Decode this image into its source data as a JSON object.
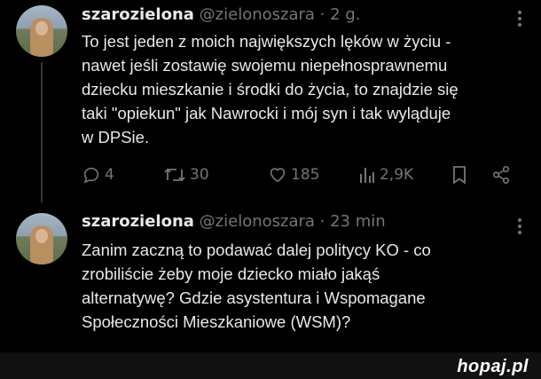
{
  "tweets": [
    {
      "name": "szarozielona",
      "handle": "@zielonoszara",
      "time": " · 2 g.",
      "text": "To jest jeden z moich największych lęków w życiu -\nnawet jeśli zostawię swojemu niepełnosprawnemu\ndziecku mieszkanie i środki do życia, to znajdzie się\ntaki \"opiekun\" jak Nawrocki i mój syn i tak wyląduje\nw DPSie.",
      "replies": "4",
      "retweets": "30",
      "likes": "185",
      "views": "2,9K"
    },
    {
      "name": "szarozielona",
      "handle": "@zielonoszara",
      "time": " · 23 min",
      "text": "Zanim zaczną to podawać dalej politycy KO - co\nzrobiliście żeby moje dziecko miało jakąś\nalternatywę? Gdzie asystentura i Wspomagane\nSpołeczności Mieszkaniowe (WSM)?"
    }
  ],
  "icons": {
    "reply": "reply-icon",
    "retweet": "retweet-icon",
    "like": "heart-icon",
    "views": "views-icon",
    "bookmark": "bookmark-icon",
    "share": "share-icon",
    "more": "more-icon"
  },
  "watermark": "hopaj.pl",
  "colors": {
    "background": "#000000",
    "text": "#e7e9ea",
    "muted": "#71767b"
  }
}
